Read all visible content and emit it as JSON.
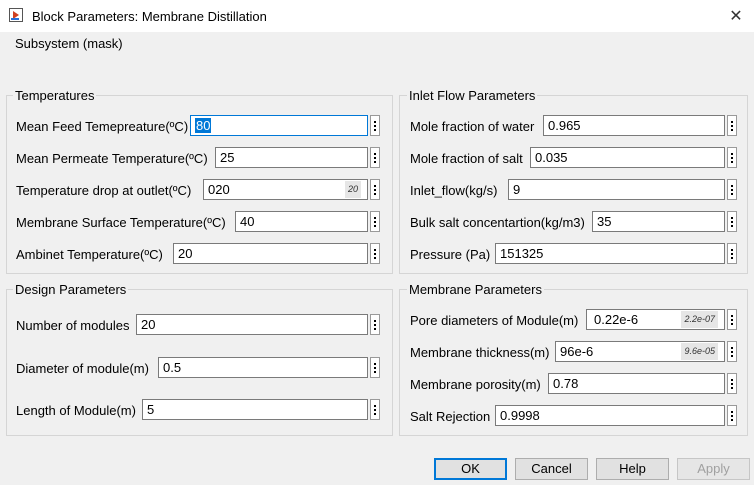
{
  "window": {
    "title": "Block Parameters: Membrane Distillation"
  },
  "header": {
    "subsystem_label": "Subsystem (mask)"
  },
  "temperatures": {
    "title": "Temperatures",
    "mean_feed": {
      "label": "Mean Feed Temepreature(ºC)",
      "value": "80"
    },
    "mean_permeate": {
      "label": "Mean Permeate Temperature(ºC)",
      "value": "25"
    },
    "temp_drop": {
      "label": "Temperature drop at outlet(ºC)",
      "value": "020",
      "hint": "20"
    },
    "membrane_surface": {
      "label": "Membrane Surface Temperature(ºC)",
      "value": "40"
    },
    "ambient": {
      "label": "Ambinet Temperature(ºC)",
      "value": "20"
    }
  },
  "inlet": {
    "title": "Inlet Flow Parameters",
    "mole_water": {
      "label": "Mole fraction of water",
      "value": "0.965"
    },
    "mole_salt": {
      "label": "Mole fraction of salt",
      "value": "0.035"
    },
    "inlet_flow": {
      "label": "Inlet_flow(kg/s)",
      "value": "9"
    },
    "bulk_salt": {
      "label": "Bulk salt concentartion(kg/m3)",
      "value": "35"
    },
    "pressure": {
      "label": "Pressure (Pa)",
      "value": "151325"
    }
  },
  "design": {
    "title": "Design Parameters",
    "modules": {
      "label": "Number of modules",
      "value": "20"
    },
    "diameter": {
      "label": "Diameter of module(m)",
      "value": "0.5"
    },
    "length": {
      "label": "Length of Module(m)",
      "value": "5"
    }
  },
  "membrane": {
    "title": "Membrane Parameters",
    "pore": {
      "label": "Pore diameters of Module(m)",
      "value": "0.22e-6",
      "hint": "2.2e-07"
    },
    "thickness": {
      "label": "Membrane thickness(m)",
      "value": "96e-6",
      "hint": "9.6e-05"
    },
    "porosity": {
      "label": "Membrane porosity(m)",
      "value": "0.78"
    },
    "salt_rejection": {
      "label": "Salt Rejection",
      "value": "0.9998"
    }
  },
  "buttons": {
    "ok": "OK",
    "cancel": "Cancel",
    "help": "Help",
    "apply": "Apply"
  }
}
